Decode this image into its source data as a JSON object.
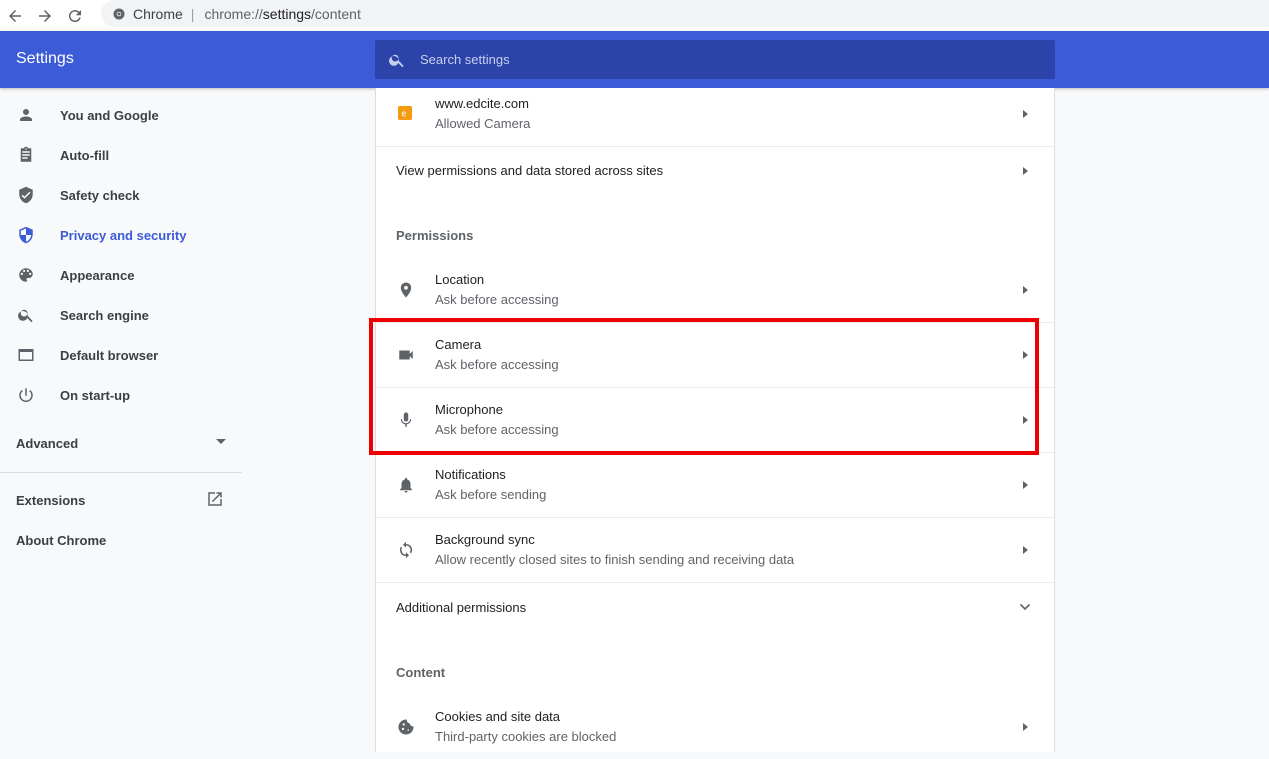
{
  "browser": {
    "host": "Chrome",
    "url_prefix": "chrome://",
    "url_main": "settings",
    "url_suffix": "/content"
  },
  "header": {
    "title": "Settings",
    "search_placeholder": "Search settings"
  },
  "sidebar": {
    "items": [
      {
        "label": "You and Google",
        "icon": "person-icon"
      },
      {
        "label": "Auto-fill",
        "icon": "clipboard-icon"
      },
      {
        "label": "Safety check",
        "icon": "shield-check-icon"
      },
      {
        "label": "Privacy and security",
        "icon": "shield-icon",
        "active": true
      },
      {
        "label": "Appearance",
        "icon": "palette-icon"
      },
      {
        "label": "Search engine",
        "icon": "search-icon"
      },
      {
        "label": "Default browser",
        "icon": "browser-icon"
      },
      {
        "label": "On start-up",
        "icon": "power-icon"
      }
    ],
    "advanced_label": "Advanced",
    "extensions_label": "Extensions",
    "about_label": "About Chrome"
  },
  "content": {
    "site_row": {
      "title": "www.edcite.com",
      "subtitle": "Allowed Camera"
    },
    "view_permissions": "View permissions and data stored across sites",
    "permissions_title": "Permissions",
    "permissions": [
      {
        "title": "Location",
        "subtitle": "Ask before accessing",
        "icon": "location-icon"
      },
      {
        "title": "Camera",
        "subtitle": "Ask before accessing",
        "icon": "camera-icon"
      },
      {
        "title": "Microphone",
        "subtitle": "Ask before accessing",
        "icon": "microphone-icon"
      },
      {
        "title": "Notifications",
        "subtitle": "Ask before sending",
        "icon": "bell-icon"
      },
      {
        "title": "Background sync",
        "subtitle": "Allow recently closed sites to finish sending and receiving data",
        "icon": "sync-icon"
      }
    ],
    "additional_permissions": "Additional permissions",
    "content_title": "Content",
    "cookies": {
      "title": "Cookies and site data",
      "subtitle": "Third-party cookies are blocked"
    }
  },
  "colors": {
    "header": "#3c5bd6",
    "search": "#2c44aa",
    "active": "#3c5bd6",
    "highlight": "#ee0000"
  }
}
